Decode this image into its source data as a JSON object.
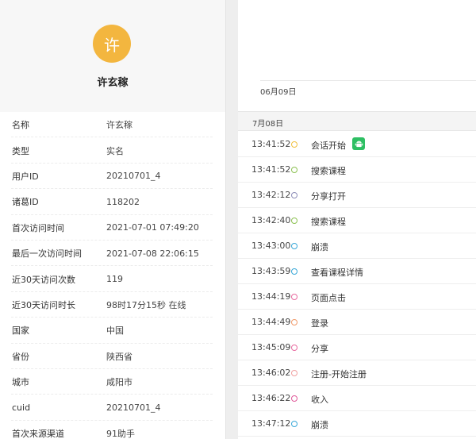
{
  "profile": {
    "avatar_char": "许",
    "name": "许玄稼",
    "avatar_color": "#f3b63f"
  },
  "fields": [
    {
      "key": "名称",
      "value": "许玄稼"
    },
    {
      "key": "类型",
      "value": "实名"
    },
    {
      "key": "用户ID",
      "value": "20210701_4"
    },
    {
      "key": "诸葛ID",
      "value": "118202"
    },
    {
      "key": "首次访问时间",
      "value": "2021-07-01 07:49:20"
    },
    {
      "key": "最后一次访问时间",
      "value": "2021-07-08 22:06:15"
    },
    {
      "key": "近30天访问次数",
      "value": "119"
    },
    {
      "key": "近30天访问时长",
      "value": "98时17分15秒 在线"
    },
    {
      "key": "国家",
      "value": "中国"
    },
    {
      "key": "省份",
      "value": "陕西省"
    },
    {
      "key": "城市",
      "value": "咸阳市"
    },
    {
      "key": "cuid",
      "value": "20210701_4"
    },
    {
      "key": "首次来源渠道",
      "value": "91助手"
    }
  ],
  "timeline": {
    "axis_date": "06月09日",
    "day_header": "7月08日",
    "events": [
      {
        "time": "13:41:52",
        "label": "会话开始",
        "dot_color": "#f0c040",
        "badge": "android-icon"
      },
      {
        "time": "13:41:52",
        "label": "搜索课程",
        "dot_color": "#8cc152",
        "badge": ""
      },
      {
        "time": "13:42:12",
        "label": "分享打开",
        "dot_color": "#8e8eb8",
        "badge": ""
      },
      {
        "time": "13:42:40",
        "label": "搜索课程",
        "dot_color": "#8cc152",
        "badge": ""
      },
      {
        "time": "13:43:00",
        "label": "崩溃",
        "dot_color": "#3aa8d8",
        "badge": ""
      },
      {
        "time": "13:43:59",
        "label": "查看课程详情",
        "dot_color": "#3aa8d8",
        "badge": ""
      },
      {
        "time": "13:44:19",
        "label": "页面点击",
        "dot_color": "#e86aa0",
        "badge": ""
      },
      {
        "time": "13:44:49",
        "label": "登录",
        "dot_color": "#f09a6a",
        "badge": ""
      },
      {
        "time": "13:45:09",
        "label": "分享",
        "dot_color": "#e86aa0",
        "badge": ""
      },
      {
        "time": "13:46:02",
        "label": "注册-开始注册",
        "dot_color": "#f0a0a0",
        "badge": ""
      },
      {
        "time": "13:46:22",
        "label": "收入",
        "dot_color": "#e05a9a",
        "badge": ""
      },
      {
        "time": "13:47:12",
        "label": "崩溃",
        "dot_color": "#3aa8d8",
        "badge": ""
      }
    ]
  }
}
